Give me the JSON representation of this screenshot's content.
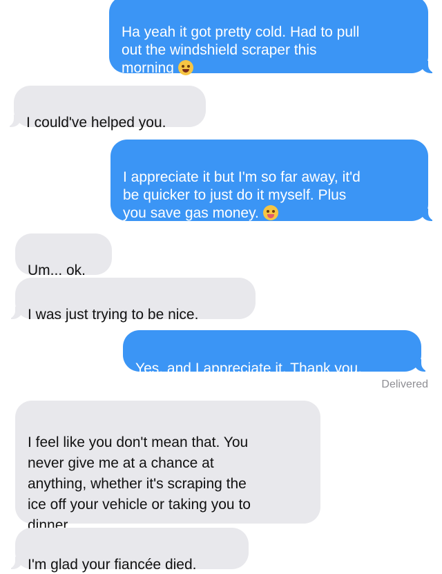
{
  "messages": [
    {
      "id": "m1",
      "direction": "sent",
      "text": "Ha yeah it got pretty cold. Had to pull\nout the windshield scraper this\nmorning",
      "emoji": "tired-face-icon"
    },
    {
      "id": "m2",
      "direction": "received",
      "text": "I could've helped you."
    },
    {
      "id": "m3",
      "direction": "sent",
      "text": "I appreciate it but I'm so far away, it'd\nbe quicker to just do it myself. Plus\nyou save gas money.",
      "emoji": "tongue-face-icon"
    },
    {
      "id": "m4",
      "direction": "received",
      "text": "Um... ok."
    },
    {
      "id": "m5",
      "direction": "received",
      "text": "I was just trying to be nice."
    },
    {
      "id": "m6",
      "direction": "sent",
      "text": "Yes, and I appreciate it. Thank you."
    },
    {
      "id": "m7",
      "direction": "received",
      "text": "I feel like you don't mean that. You\nnever give me at a chance at\nanything, whether it's scraping the\nice off your vehicle or taking you to\ndinner."
    },
    {
      "id": "m8",
      "direction": "received",
      "text": "I'm glad your fiancée died."
    }
  ],
  "status": {
    "delivered": "Delivered"
  },
  "colors": {
    "sent_bubble": "#3b95f5",
    "received_bubble": "#e8e8ec",
    "status_text": "#8e8e93"
  }
}
